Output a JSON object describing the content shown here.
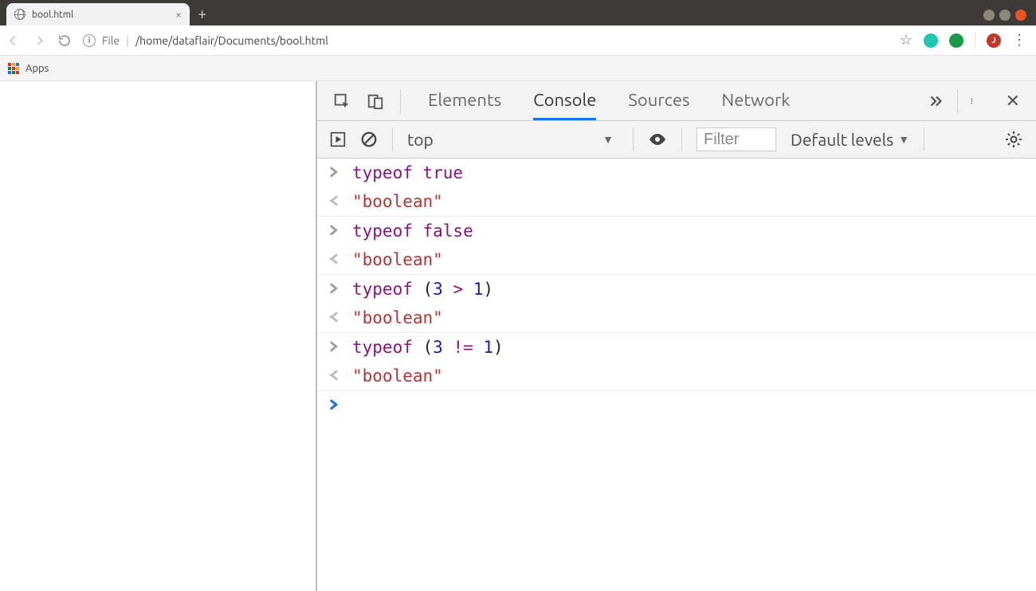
{
  "tab": {
    "title": "bool.html"
  },
  "address": {
    "scheme": "File",
    "path": "/home/dataflair/Documents/bool.html"
  },
  "bookmarks": {
    "apps": "Apps"
  },
  "avatar": {
    "letter": "J"
  },
  "devtools": {
    "tabs": {
      "elements": "Elements",
      "console": "Console",
      "sources": "Sources",
      "network": "Network"
    },
    "toolbar": {
      "context": "top",
      "filter_placeholder": "Filter",
      "levels": "Default levels"
    },
    "entries": [
      {
        "input": {
          "kw": "typeof",
          "rest": " true"
        },
        "output": "\"boolean\""
      },
      {
        "input": {
          "kw": "typeof",
          "rest": " false"
        },
        "output": "\"boolean\""
      },
      {
        "input": {
          "kw": "typeof",
          "expr": {
            "open": " (",
            "n1": "3",
            "op": " > ",
            "n2": "1",
            "close": ")"
          }
        },
        "output": "\"boolean\""
      },
      {
        "input": {
          "kw": "typeof",
          "expr": {
            "open": " (",
            "n1": "3",
            "op": " != ",
            "n2": "1",
            "close": ")"
          }
        },
        "output": "\"boolean\""
      }
    ]
  }
}
